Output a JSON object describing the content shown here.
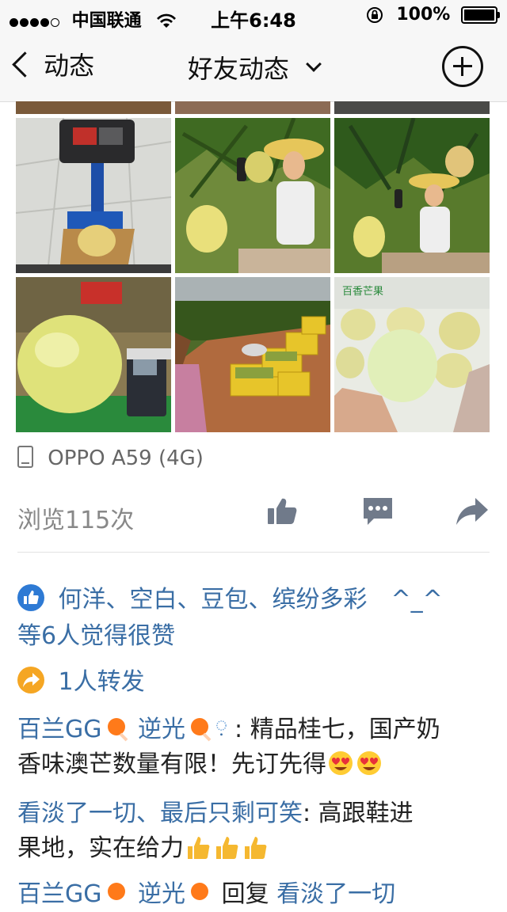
{
  "status_bar": {
    "carrier": "中国联通",
    "time": "上午6:48",
    "battery": "100%"
  },
  "nav": {
    "back_label": "动态",
    "title": "好友动态"
  },
  "photo_caption": "百香芒果",
  "device": "OPPO A59 (4G)",
  "views": "浏览115次",
  "likes": {
    "names": "何洋、空白、豆包、缤纷多彩　^_^",
    "suffix": "等6人觉得很赞"
  },
  "shares": "1人转发",
  "comments": [
    {
      "author": "百兰GG",
      "author2": "逆光",
      "text_line1": ": 精品桂七，国产奶",
      "text_line2": "香味澳芒数量有限！先订先得"
    },
    {
      "author": "看淡了一切、最后只剩可笑",
      "text_line1": ": 高跟鞋进",
      "text_line2": "果地，实在给力"
    },
    {
      "author": "百兰GG",
      "author2": "逆光",
      "reply_word": "回复",
      "reply_to": "看淡了一切"
    }
  ],
  "colors": {
    "link": "#3a6ea5",
    "like_icon": "#2e7ad4",
    "share_icon": "#f5a623",
    "action_icon": "#707a8a"
  }
}
